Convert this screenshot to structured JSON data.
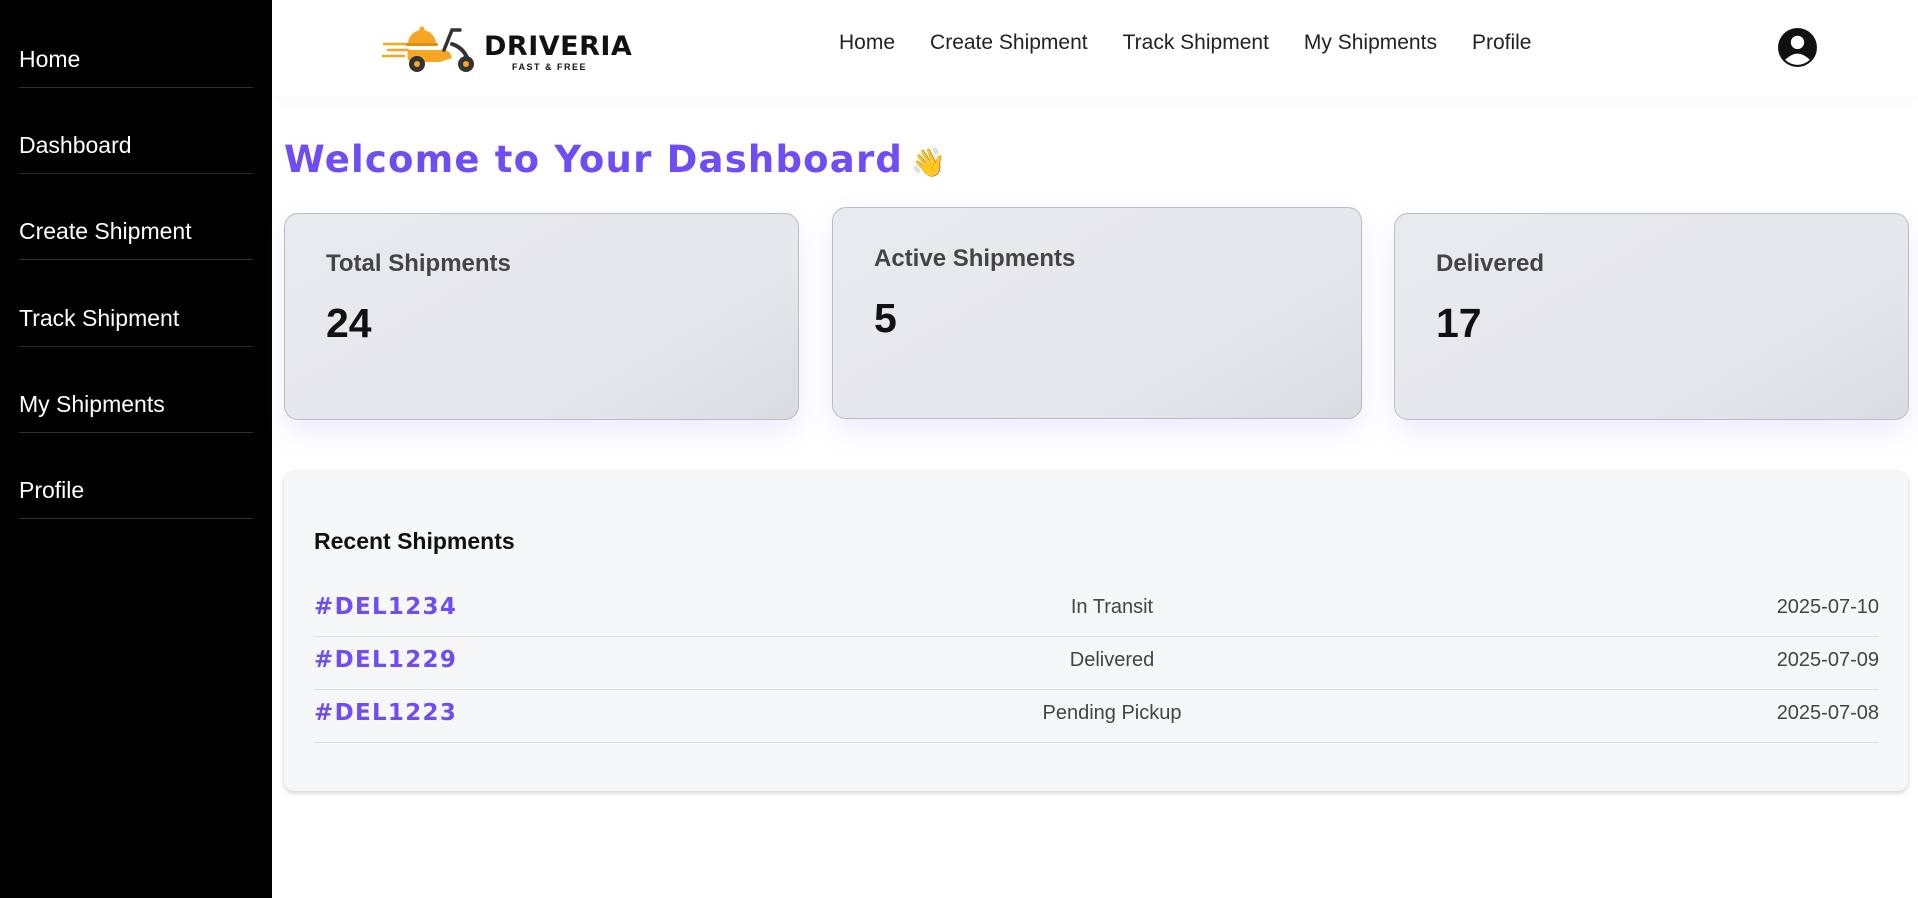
{
  "sidebar": {
    "items": [
      {
        "label": "Home"
      },
      {
        "label": "Dashboard"
      },
      {
        "label": "Create Shipment"
      },
      {
        "label": "Track Shipment"
      },
      {
        "label": "My Shipments"
      },
      {
        "label": "Profile"
      }
    ]
  },
  "header": {
    "brand": {
      "name": "DRIVERIA",
      "tagline": "FAST & FREE"
    },
    "nav": [
      {
        "label": "Home"
      },
      {
        "label": "Create Shipment"
      },
      {
        "label": "Track Shipment"
      },
      {
        "label": "My Shipments"
      },
      {
        "label": "Profile"
      }
    ],
    "avatar_icon": "user-circle-icon"
  },
  "main": {
    "title": "Welcome to Your Dashboard",
    "title_emoji": "👋",
    "stats": [
      {
        "label": "Total Shipments",
        "value": "24"
      },
      {
        "label": "Active Shipments",
        "value": "5"
      },
      {
        "label": "Delivered",
        "value": "17"
      }
    ],
    "recent": {
      "title": "Recent Shipments",
      "rows": [
        {
          "id": "#DEL1234",
          "status": "In Transit",
          "date": "2025-07-10"
        },
        {
          "id": "#DEL1229",
          "status": "Delivered",
          "date": "2025-07-09"
        },
        {
          "id": "#DEL1223",
          "status": "Pending Pickup",
          "date": "2025-07-08"
        }
      ]
    }
  },
  "colors": {
    "accent": "#6f4cf4",
    "sidebar_bg": "#000000",
    "logo_orange": "#f5a623"
  }
}
